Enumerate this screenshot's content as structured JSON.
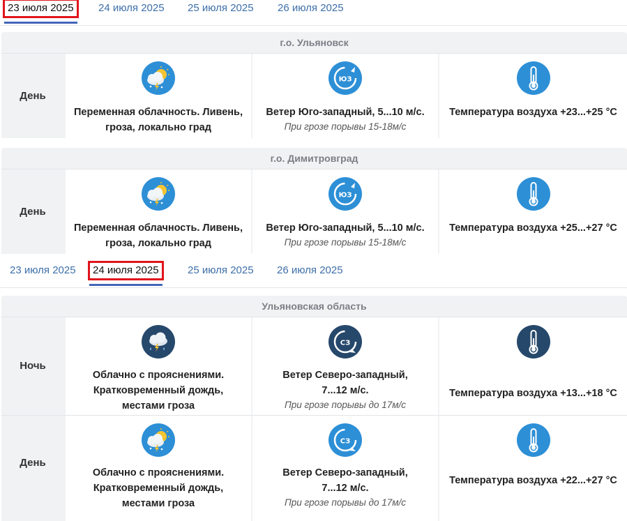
{
  "tabs_top": [
    {
      "label": "23 июля 2025",
      "active": true
    },
    {
      "label": "24 июля 2025",
      "active": false
    },
    {
      "label": "25 июля 2025",
      "active": false
    },
    {
      "label": "26 июля 2025",
      "active": false
    }
  ],
  "tabs_bottom": [
    {
      "label": "23 июля 2025",
      "active": false
    },
    {
      "label": "24 июля 2025",
      "active": true
    },
    {
      "label": "25 июля 2025",
      "active": false
    },
    {
      "label": "26 июля 2025",
      "active": false
    }
  ],
  "ulyanovsk": {
    "title": "г.о. Ульяновск",
    "day": {
      "period": "День",
      "weather_line1": "Переменная облачность. Ливень,",
      "weather_line2": "гроза, локально град",
      "wind": "Ветер Юго-западный, 5...10 м/с.",
      "wind_note": "При грозе порывы 15-18м/с",
      "wind_dir": "ЮЗ",
      "temp": "Температура воздуха +23...+25 °C"
    }
  },
  "dimitrovgrad": {
    "title": "г.о. Димитровград",
    "day": {
      "period": "День",
      "weather_line1": "Переменная облачность. Ливень,",
      "weather_line2": "гроза, локально град",
      "wind": "Ветер Юго-западный, 5...10 м/с.",
      "wind_note": "При грозе порывы 15-18м/с",
      "wind_dir": "ЮЗ",
      "temp": "Температура воздуха +25...+27 °C"
    }
  },
  "oblast": {
    "title": "Ульяновская область",
    "night": {
      "period": "Ночь",
      "weather_line1": "Облачно с прояснениями.",
      "weather_line2": "Кратковременный дождь,",
      "weather_line3": "местами гроза",
      "wind_line1": "Ветер Северо-западный,",
      "wind_line2": "7...12 м/с.",
      "wind_note": "При грозе порывы до 17м/с",
      "wind_dir": "СЗ",
      "temp": "Температура воздуха +13...+18 °C"
    },
    "day": {
      "period": "День",
      "weather_line1": "Облачно с прояснениями.",
      "weather_line2": "Кратковременный дождь,",
      "weather_line3": "местами гроза",
      "wind_line1": "Ветер Северо-западный,",
      "wind_line2": "7...12 м/с.",
      "wind_note": "При грозе порывы до 17м/с",
      "wind_dir": "СЗ",
      "temp": "Температура воздуха +22...+27 °C"
    }
  },
  "colors": {
    "day_icon": "#2d8fd6",
    "night_icon": "#26486b",
    "tab_link": "#3d6fa8",
    "active_outline": "#e0141c",
    "active_underline": "#4466b8"
  }
}
